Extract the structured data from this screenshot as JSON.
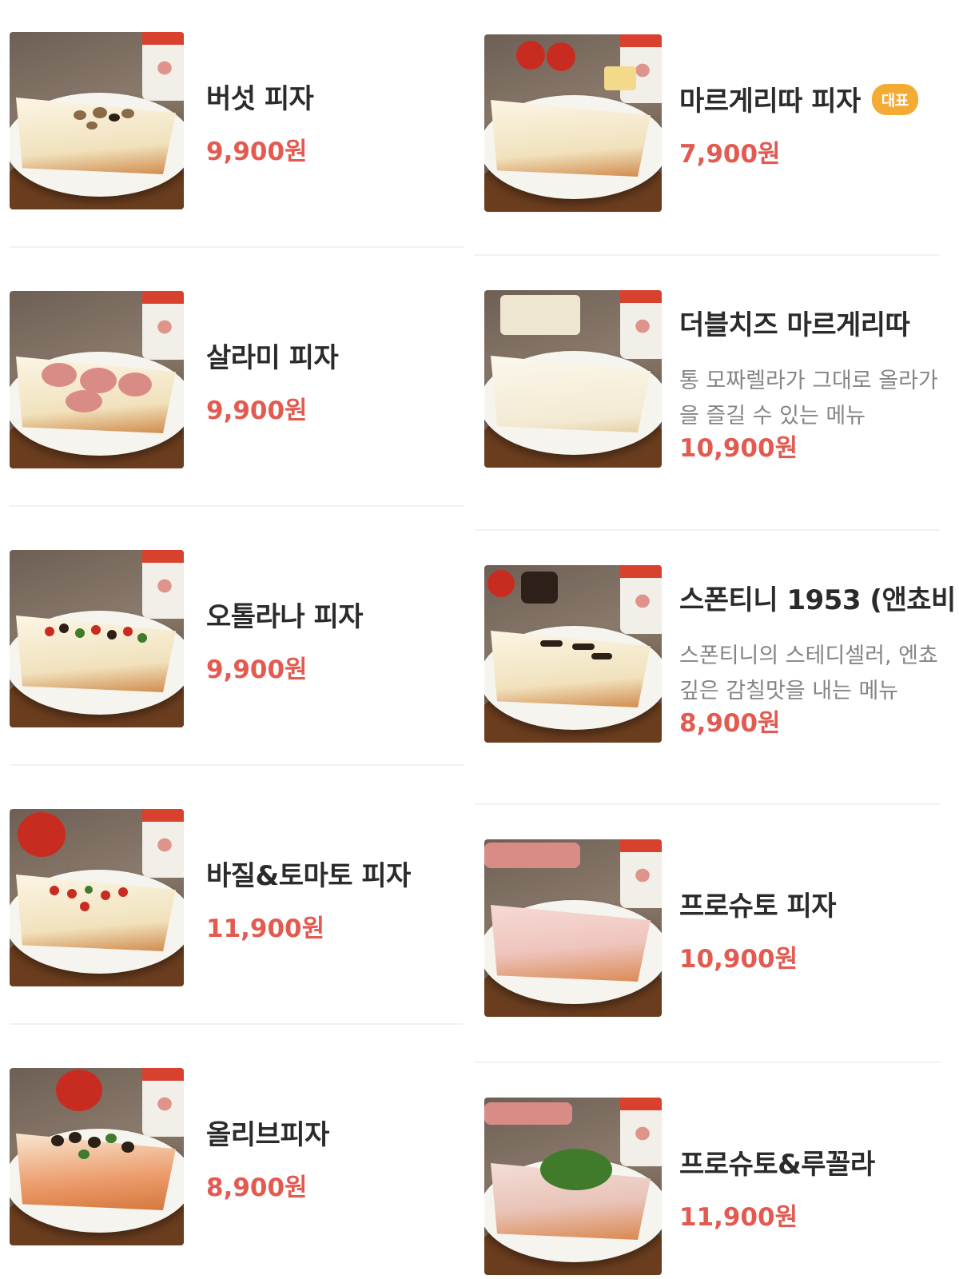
{
  "menu": {
    "left": [
      {
        "name": "버섯 피자",
        "price": "9,900원",
        "image": "mushroom-pizza-photo"
      },
      {
        "name": "살라미 피자",
        "price": "9,900원",
        "image": "salami-pizza-photo"
      },
      {
        "name": "오톨라나 피자",
        "price": "9,900원",
        "image": "ortolana-pizza-photo"
      },
      {
        "name": "바질&토마토 피자",
        "price": "11,900원",
        "image": "basil-tomato-pizza-photo"
      },
      {
        "name": "올리브피자",
        "price": "8,900원",
        "image": "olive-pizza-photo"
      }
    ],
    "right": [
      {
        "name": "마르게리따 피자",
        "badge": "대표",
        "price": "7,900원",
        "image": "margherita-pizza-photo"
      },
      {
        "name": "더블치즈 마르게리따",
        "desc_line1": "통 모짜렐라가 그대로 올라가",
        "desc_line2": "을 즐길 수 있는 메뉴",
        "price": "10,900원",
        "image": "double-cheese-margherita-photo"
      },
      {
        "name": "스폰티니 1953 (앤쵸비",
        "desc_line1": "스폰티니의 스테디셀러, 엔쵸",
        "desc_line2": "깊은 감칠맛을 내는 메뉴",
        "price": "8,900원",
        "image": "spontini-anchovy-pizza-photo"
      },
      {
        "name": "프로슈토 피자",
        "price": "10,900원",
        "image": "prosciutto-pizza-photo"
      },
      {
        "name": "프로슈토&루꼴라",
        "price": "11,900원",
        "image": "prosciutto-rucola-pizza-photo"
      }
    ]
  },
  "colors": {
    "price": "#e25a50",
    "badge": "#f4ab33",
    "name": "#2b2b2b",
    "description": "#858585",
    "divider": "#f1f1f1"
  }
}
